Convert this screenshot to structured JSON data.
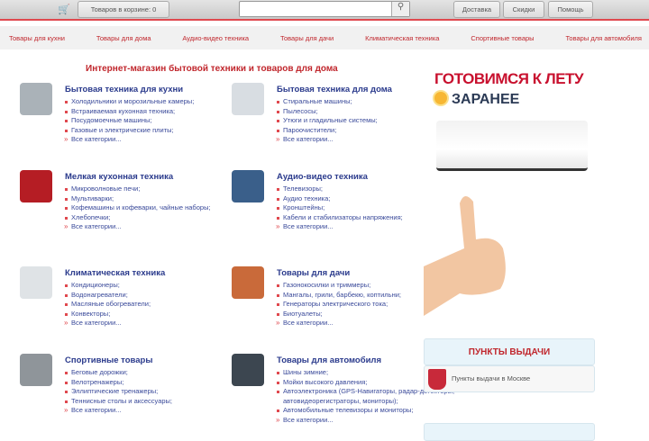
{
  "header": {
    "cart_label": "Товаров в корзине: 0",
    "search_placeholder": "",
    "links": [
      "Доставка",
      "Скидки",
      "Помощь"
    ]
  },
  "nav": [
    "Товары для кухни",
    "Товары для дома",
    "Аудио-видео техника",
    "Товары для дачи",
    "Климатическая техника",
    "Спортивные товары",
    "Товары для автомобиля"
  ],
  "main": {
    "title": "Интернет-магазин бытовой техники и товаров для дома",
    "all_label": "Все категории...",
    "categories": [
      {
        "title": "Бытовая техника для кухни",
        "items": [
          "Холодильники и морозильные камеры;",
          "Встраиваемая кухонная техника;",
          "Посудомоечные машины;",
          "Газовые и электрические плиты;"
        ]
      },
      {
        "title": "Бытовая техника для дома",
        "items": [
          "Стиральные машины;",
          "Пылесосы;",
          "Утюги и гладильные системы;",
          "Пароочистители;"
        ]
      },
      {
        "title": "Мелкая кухонная техника",
        "items": [
          "Микроволновые печи;",
          "Мультиварки;",
          "Кофемашины и кофеварки, чайные наборы;",
          "Хлебопечки;"
        ]
      },
      {
        "title": "Аудио-видео техника",
        "items": [
          "Телевизоры;",
          "Аудио техника;",
          "Кронштейны;",
          "Кабели и стабилизаторы напряжения;"
        ]
      },
      {
        "title": "Климатическая техника",
        "items": [
          "Кондиционеры;",
          "Водонагреватели;",
          "Масляные обогреватели;",
          "Конвекторы;"
        ]
      },
      {
        "title": "Товары для дачи",
        "items": [
          "Газонокосилки и триммеры;",
          "Мангалы, грили, барбекю, коптильни;",
          "Генераторы электрического тока;",
          "Биотуалеты;"
        ]
      },
      {
        "title": "Спортивные товары",
        "items": [
          "Беговые дорожки;",
          "Велотренажеры;",
          "Эллиптические тренажеры;",
          "Теннисные столы и аксессуары;"
        ]
      },
      {
        "title": "Товары для автомобиля",
        "items": [
          "Шины зимние;",
          "Мойки высокого давления;",
          "Автоэлектроника (GPS-Навигаторы, радар-детекторы, автовидеорегистраторы, мониторы);",
          "Автомобильные телевизоры и мониторы;"
        ]
      }
    ]
  },
  "sidebar": {
    "promo_line1": "ГОТОВИМСЯ К ЛЕТУ",
    "promo_line2": "ЗАРАНЕЕ",
    "pickup_title": "ПУНКТЫ ВЫДАЧИ",
    "pickup_item": "Пункты выдачи в Москве"
  }
}
